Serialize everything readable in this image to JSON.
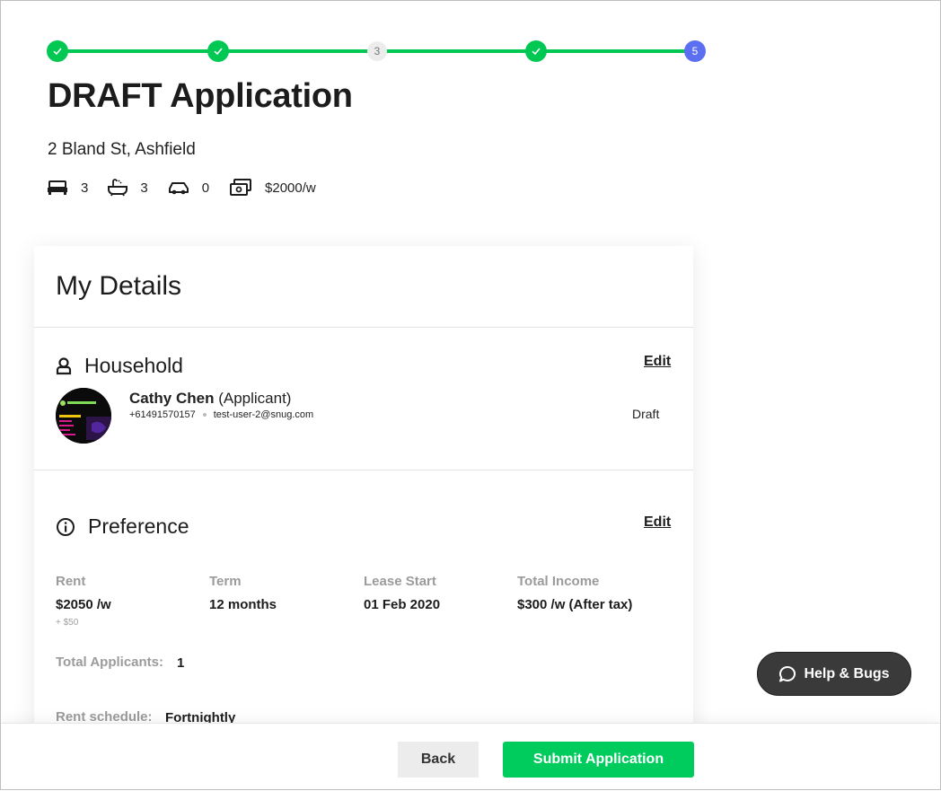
{
  "stepper": {
    "steps": [
      {
        "state": "done"
      },
      {
        "state": "done"
      },
      {
        "state": "pending",
        "label": "3"
      },
      {
        "state": "done"
      },
      {
        "state": "current",
        "label": "5"
      }
    ],
    "colors": {
      "done": "#00c853",
      "current": "#5b6ff0"
    }
  },
  "page": {
    "title": "DRAFT Application",
    "address": "2 Bland St, Ashfield"
  },
  "features": {
    "bedrooms": "3",
    "bathrooms": "3",
    "parking": "0",
    "rent": "$2000/w"
  },
  "card": {
    "title": "My Details"
  },
  "household": {
    "heading": "Household",
    "edit_label": "Edit",
    "applicant_name": "Cathy Chen",
    "applicant_role": "(Applicant)",
    "phone": "+61491570157",
    "email": "test-user-2@snug.com",
    "status": "Draft"
  },
  "preference": {
    "heading": "Preference",
    "edit_label": "Edit",
    "rent_label": "Rent",
    "rent_value": "$2050 /w",
    "rent_extra": "+ $50",
    "term_label": "Term",
    "term_value": "12 months",
    "lease_start_label": "Lease Start",
    "lease_start_value": "01 Feb 2020",
    "income_label": "Total Income",
    "income_value": "$300 /w (After tax)",
    "applicants_label": "Total Applicants:",
    "applicants_value": "1",
    "schedule_label": "Rent schedule:",
    "schedule_value": "Fortnightly"
  },
  "footer": {
    "back_label": "Back",
    "submit_label": "Submit Application"
  },
  "help": {
    "label": "Help & Bugs"
  },
  "accent_colors": {
    "submit": "#00cc5e",
    "help_button": "#3a3a3a"
  }
}
